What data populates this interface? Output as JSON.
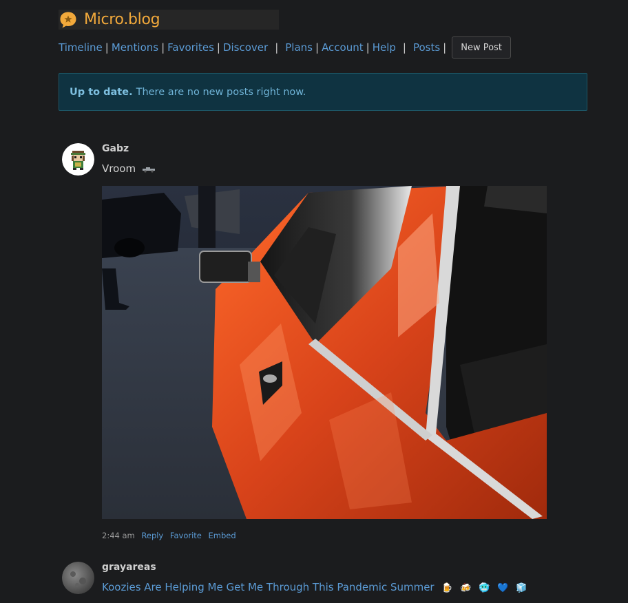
{
  "app": {
    "name": "Micro.blog",
    "logo_icon": "speech-bubble-star-icon",
    "accent": "#f2a93b"
  },
  "nav": {
    "items": [
      {
        "label": "Timeline"
      },
      {
        "label": "Mentions"
      },
      {
        "label": "Favorites"
      },
      {
        "label": "Discover"
      },
      {
        "label": "Plans"
      },
      {
        "label": "Account"
      },
      {
        "label": "Help"
      },
      {
        "label": "Posts"
      }
    ],
    "new_post_label": "New Post",
    "link_color": "#5b9bd5"
  },
  "alert": {
    "title": "Up to date.",
    "message": "There are no new posts right now."
  },
  "posts": [
    {
      "author": "Gabz",
      "text": "Vroom",
      "text_emoji": "racing-car-icon",
      "has_photo": true,
      "photo_subject": "orange-car-photo",
      "time": "2:44 am",
      "actions": [
        "Reply",
        "Favorite",
        "Embed"
      ]
    },
    {
      "author": "grayareas",
      "link_text": "Koozies Are Helping Me Get Me Through This Pandemic Summer",
      "emojis": [
        "🍺",
        "🍻",
        "🥶",
        "💙",
        "🧊"
      ]
    }
  ]
}
